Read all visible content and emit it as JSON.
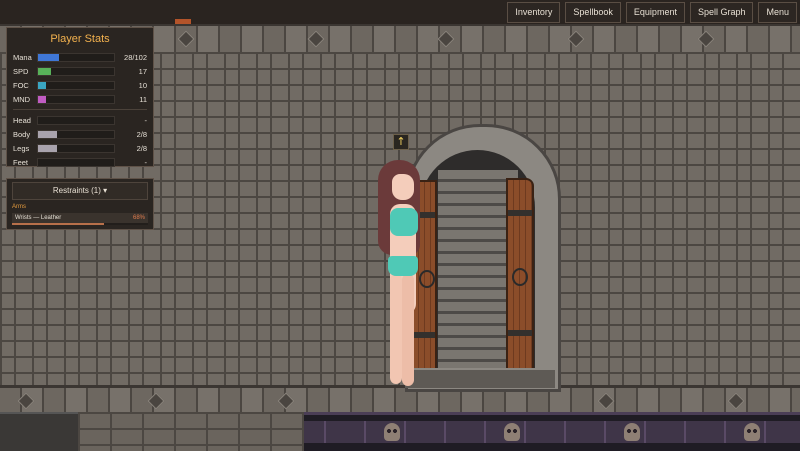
{
  "menu": {
    "items": [
      {
        "label": "Inventory"
      },
      {
        "label": "Spellbook"
      },
      {
        "label": "Equipment"
      },
      {
        "label": "Spell Graph"
      },
      {
        "label": "Menu"
      }
    ]
  },
  "stats": {
    "title": "Player Stats",
    "rows": [
      {
        "label": "Mana",
        "value": "28/102",
        "fraction": 0.27,
        "color": "#3f77d6"
      },
      {
        "label": "SPD",
        "value": "17",
        "fraction": 0.17,
        "color": "#58b259"
      },
      {
        "label": "FOC",
        "value": "10",
        "fraction": 0.1,
        "color": "#3aa6c2"
      },
      {
        "label": "MND",
        "value": "11",
        "fraction": 0.11,
        "color": "#c05cc2"
      }
    ],
    "limbs": [
      {
        "label": "Head",
        "value": "-",
        "fraction": 0
      },
      {
        "label": "Body",
        "value": "2/8",
        "fraction": 0.25
      },
      {
        "label": "Legs",
        "value": "2/8",
        "fraction": 0.25
      },
      {
        "label": "Feet",
        "value": "-",
        "fraction": 0
      }
    ],
    "limb_color": "#a9a3ad"
  },
  "restraints": {
    "header": "Restraints (1) ▾",
    "slot": "Arms",
    "item": {
      "name": "Wrists — Leather",
      "percent": "68%",
      "fraction": 0.68
    }
  },
  "marker": {
    "glyph": "↑"
  }
}
